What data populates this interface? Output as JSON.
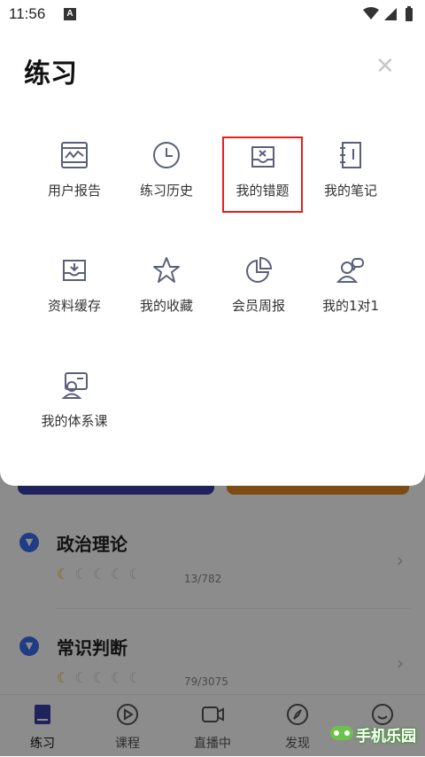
{
  "status_bar": {
    "time": "11:56",
    "notif_letter": "A"
  },
  "modal": {
    "title": "练习",
    "items": [
      {
        "label": "用户报告",
        "icon": "report-chart-icon"
      },
      {
        "label": "练习历史",
        "icon": "clock-icon"
      },
      {
        "label": "我的错题",
        "icon": "wrong-tray-icon",
        "highlighted": true
      },
      {
        "label": "我的笔记",
        "icon": "notebook-icon"
      },
      {
        "label": "资料缓存",
        "icon": "download-tray-icon"
      },
      {
        "label": "我的收藏",
        "icon": "star-icon"
      },
      {
        "label": "会员周报",
        "icon": "pie-chart-icon"
      },
      {
        "label": "我的1对1",
        "icon": "one-on-one-icon"
      },
      {
        "label": "我的体系课",
        "icon": "system-course-icon"
      }
    ]
  },
  "background": {
    "sections": [
      {
        "title": "政治理论",
        "stars_filled": 1,
        "stars_total": 5,
        "count": "13/782"
      },
      {
        "title": "常识判断",
        "stars_filled": 1,
        "stars_total": 5,
        "count": "79/3075"
      }
    ],
    "tabs": [
      {
        "label": "练习",
        "active": true
      },
      {
        "label": "课程"
      },
      {
        "label": "直播中"
      },
      {
        "label": "发现"
      },
      {
        "label": ""
      }
    ]
  },
  "watermark": {
    "text": "手机乐园"
  },
  "colors": {
    "highlight": "#e02020",
    "icon_stroke": "#5a6079",
    "accent_blue": "#3a6df0"
  }
}
